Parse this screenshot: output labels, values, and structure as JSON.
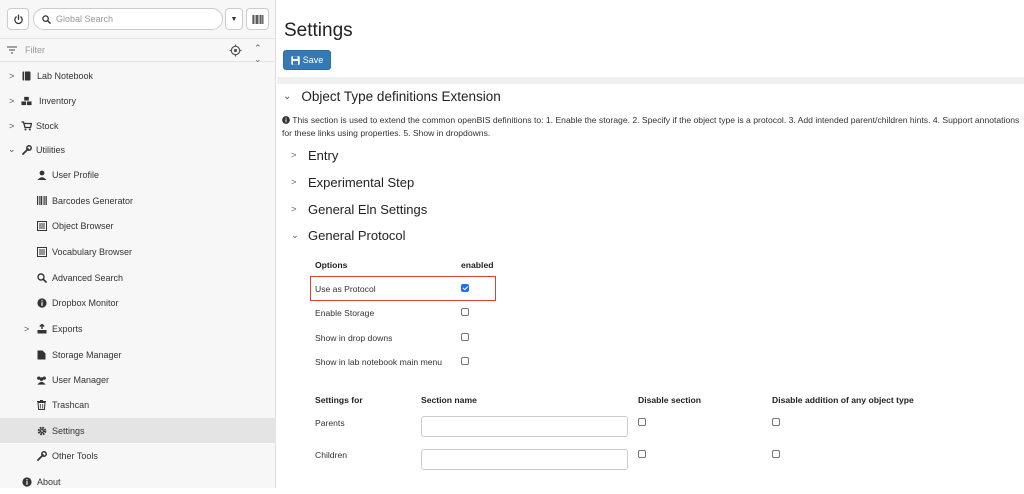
{
  "search": {
    "placeholder": "Global Search"
  },
  "filter": {
    "placeholder": "Filter"
  },
  "sidebar": {
    "items": [
      {
        "label": "Lab Notebook"
      },
      {
        "label": "Inventory"
      },
      {
        "label": "Stock"
      },
      {
        "label": "Utilities"
      },
      {
        "label": "User Profile"
      },
      {
        "label": "Barcodes Generator"
      },
      {
        "label": "Object Browser"
      },
      {
        "label": "Vocabulary Browser"
      },
      {
        "label": "Advanced Search"
      },
      {
        "label": "Dropbox Monitor"
      },
      {
        "label": "Exports"
      },
      {
        "label": "Storage Manager"
      },
      {
        "label": "User Manager"
      },
      {
        "label": "Trashcan"
      },
      {
        "label": "Settings",
        "active": true
      },
      {
        "label": "Other Tools"
      },
      {
        "label": "About"
      }
    ]
  },
  "main": {
    "title": "Settings",
    "save_label": "Save",
    "section_title": "Object Type definitions Extension",
    "info_text": "This section is used to extend the common openBIS definitions to: 1. Enable the storage. 2. Specify if the object type is a protocol. 3. Add intended parent/children hints. 4. Support annotations for these links using properties. 5. Show in dropdowns.",
    "subsections": [
      {
        "label": "Entry"
      },
      {
        "label": "Experimental Step"
      },
      {
        "label": "General Eln Settings"
      },
      {
        "label": "General Protocol"
      }
    ],
    "options_table": {
      "headers": [
        "Options",
        "enabled"
      ],
      "rows": [
        {
          "label": "Use as Protocol",
          "enabled": true
        },
        {
          "label": "Enable Storage",
          "enabled": false
        },
        {
          "label": "Show in drop downs",
          "enabled": false
        },
        {
          "label": "Show in lab notebook main menu",
          "enabled": false
        }
      ]
    },
    "settings_table": {
      "headers": [
        "Settings for",
        "Section name",
        "Disable section",
        "Disable addition of any object type"
      ],
      "rows": [
        {
          "label": "Parents",
          "section_name": "",
          "disable_section": false,
          "disable_addition": false
        },
        {
          "label": "Children",
          "section_name": "",
          "disable_section": false,
          "disable_addition": false
        }
      ]
    }
  },
  "colors": {
    "primary": "#337ab7",
    "highlight": "#e0402e",
    "checkbox_checked": "#1a73e8",
    "sidebar_bg": "#f7f7f7",
    "active_item_bg": "#e4e4e4"
  }
}
